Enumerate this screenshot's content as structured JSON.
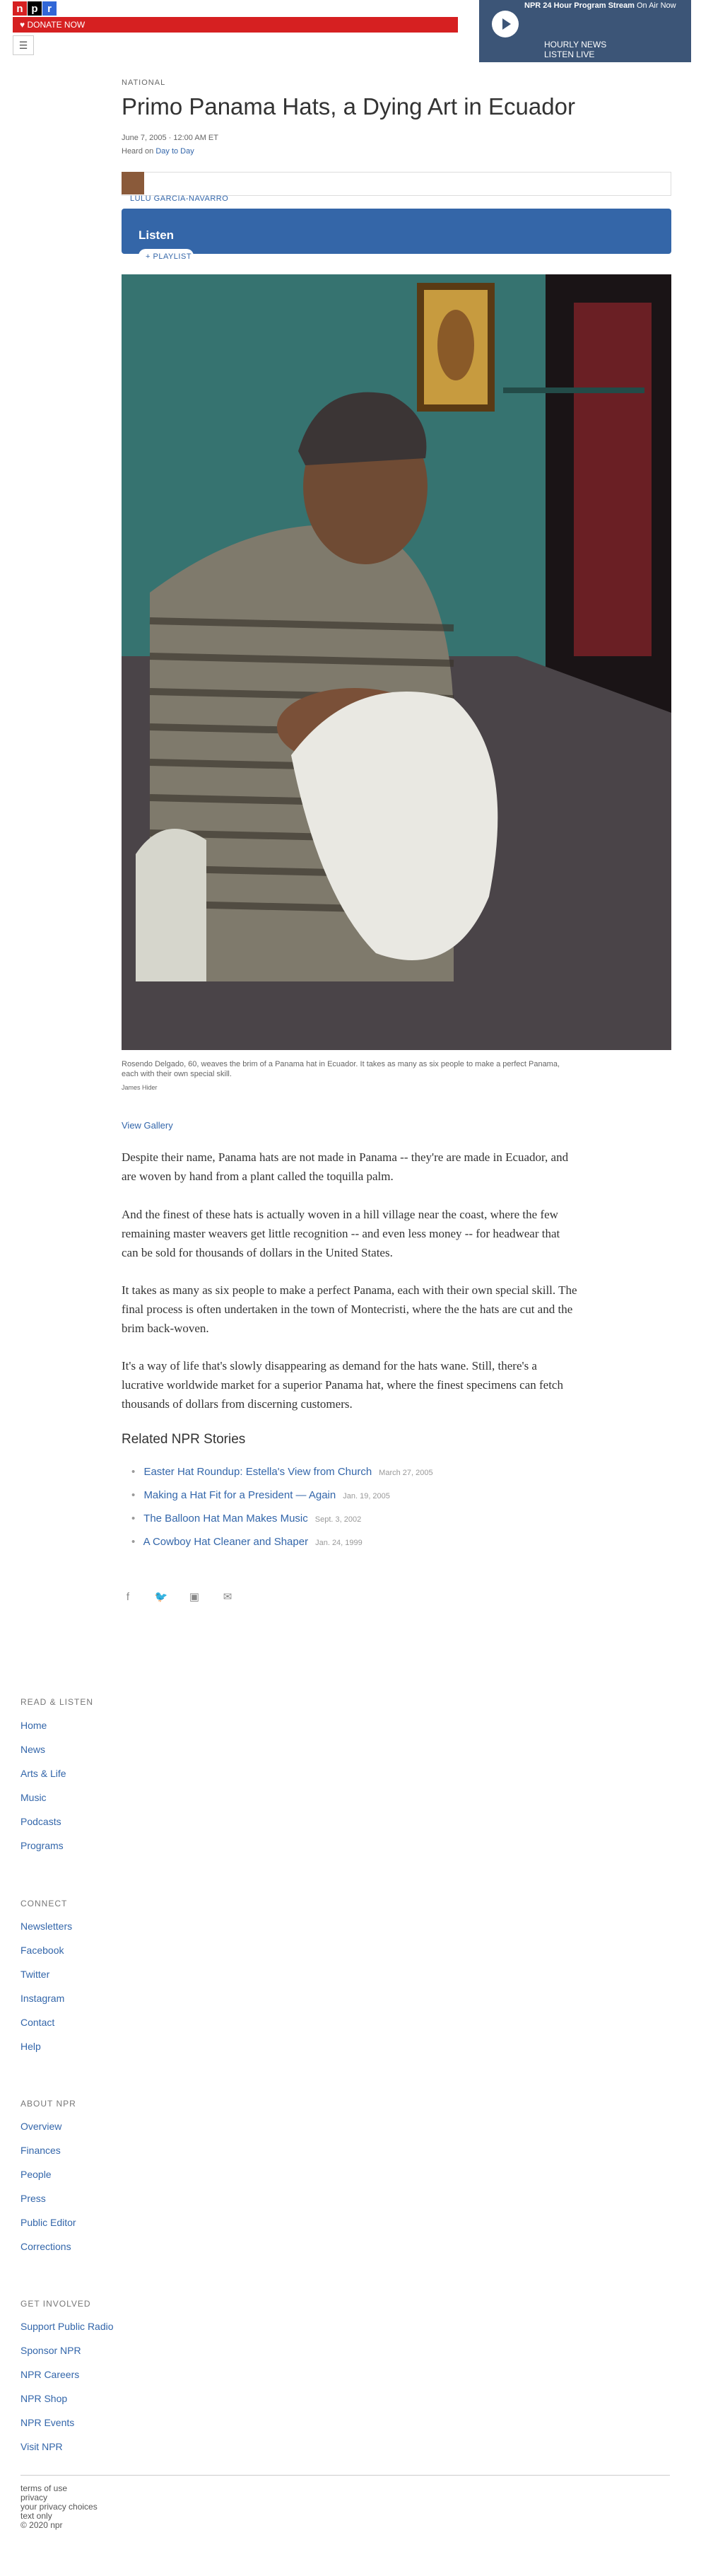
{
  "header": {
    "logo_letters": [
      "n",
      "p",
      "r"
    ],
    "logo_colors": [
      "#d62021",
      "#000000",
      "#3267d6"
    ],
    "donate": "DONATE NOW",
    "menu_icon": "hamburger-icon",
    "player": {
      "program": "NPR 24 Hour Program Stream",
      "status": "On Air Now",
      "hourly": "HOURLY NEWS",
      "live": "LISTEN LIVE"
    }
  },
  "article": {
    "section": "NATIONAL",
    "title": "Primo Panama Hats, a Dying Art in Ecuador",
    "date": "June 7, 2005 · 12:00 AM ET",
    "heard_prefix": "Heard on",
    "heard_show": "Day to Day",
    "author": "LULU GARCIA-NAVARRO",
    "listen": "Listen",
    "playlist": "PLAYLIST",
    "caption": "Rosendo Delgado, 60, weaves the brim of a Panama hat in Ecuador. It takes as many as six people to make a perfect Panama, each with their own special skill.",
    "credit": "James Hider",
    "gallery": "View Gallery",
    "paragraphs": [
      "Despite their name, Panama hats are not made in Panama -- they're are made in Ecuador, and are woven by hand from a plant called the toquilla palm.",
      "And the finest of these hats is actually woven in a hill village near the coast, where the few remaining master weavers get little recognition -- and even less money -- for headwear that can be sold for thousands of dollars in the United States.",
      "It takes as many as six people to make a perfect Panama, each with their own special skill. The final process is often undertaken in the town of Montecristi, where the the hats are cut and the brim back-woven.",
      "It's a way of life that's slowly disappearing as demand for the hats wane. Still, there's a lucrative worldwide market for a superior Panama hat, where the finest specimens can fetch thousands of dollars from discerning customers."
    ],
    "related_heading": "Related NPR Stories",
    "related": [
      {
        "title": "Easter Hat Roundup: Estella's View from Church",
        "date": "March 27, 2005"
      },
      {
        "title": "Making a Hat Fit for a President — Again",
        "date": "Jan. 19, 2005"
      },
      {
        "title": "The Balloon Hat Man Makes Music",
        "date": "Sept. 3, 2002"
      },
      {
        "title": "A Cowboy Hat Cleaner and Shaper",
        "date": "Jan. 24, 1999"
      }
    ],
    "share_icons": [
      "facebook-icon",
      "twitter-icon",
      "flipboard-icon",
      "email-icon"
    ]
  },
  "footer": {
    "groups": [
      {
        "heading": "READ & LISTEN",
        "links": [
          "Home",
          "News",
          "Arts & Life",
          "Music",
          "Podcasts",
          "Programs"
        ]
      },
      {
        "heading": "CONNECT",
        "links": [
          "Newsletters",
          "Facebook",
          "Twitter",
          "Instagram",
          "Contact",
          "Help"
        ]
      },
      {
        "heading": "ABOUT NPR",
        "links": [
          "Overview",
          "Finances",
          "People",
          "Press",
          "Public Editor",
          "Corrections"
        ]
      },
      {
        "heading": "GET INVOLVED",
        "links": [
          "Support Public Radio",
          "Sponsor NPR",
          "NPR Careers",
          "NPR Shop",
          "NPR Events",
          "Visit NPR"
        ]
      }
    ],
    "legal": [
      "terms of use",
      "privacy",
      "your privacy choices",
      "text only",
      "© 2020 npr"
    ]
  }
}
